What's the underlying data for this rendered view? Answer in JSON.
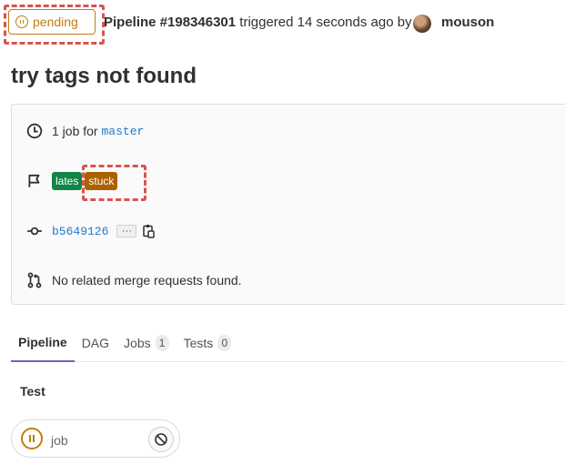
{
  "header": {
    "status": "pending",
    "pipeline_id": "Pipeline #198346301",
    "triggered_text": " triggered 14 seconds ago by",
    "username": "mouson"
  },
  "title": "try tags not found",
  "info": {
    "jobs_prefix": "1 job for",
    "branch": "master",
    "tags": [
      "lates",
      "stuck"
    ],
    "commit": "b5649126",
    "merge_requests": "No related merge requests found."
  },
  "tabs": [
    {
      "label": "Pipeline"
    },
    {
      "label": "DAG"
    },
    {
      "label": "Jobs",
      "count": "1"
    },
    {
      "label": "Tests",
      "count": "0"
    }
  ],
  "stage": {
    "title": "Test",
    "job": "job"
  },
  "colors": {
    "pending": "#c17d10",
    "latest_tag": "#108548",
    "stuck_tag": "#ab6100",
    "link": "#1f78d1",
    "highlight": "#d9534f"
  }
}
